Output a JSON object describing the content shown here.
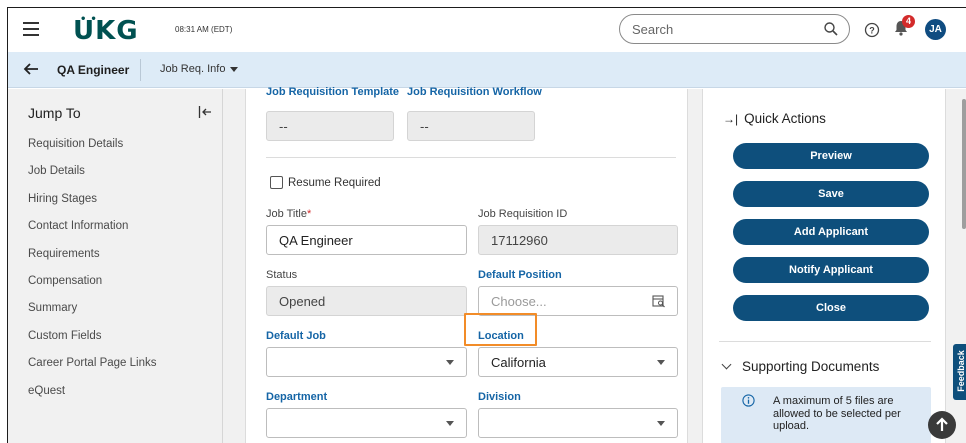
{
  "header": {
    "logo_text": "UKG",
    "logo_dots": "••",
    "time": "08:31 AM (EDT)",
    "search_placeholder": "Search",
    "notification_count": "4",
    "user_initials": "JA",
    "help_glyph": "?"
  },
  "subheader": {
    "back_glyph": "←",
    "title": "QA Engineer",
    "section_menu": "Job Req. Info"
  },
  "jump_to": {
    "title": "Jump To",
    "collapse_glyph": "|←",
    "items": [
      "Requisition Details",
      "Job Details",
      "Hiring Stages",
      "Contact Information",
      "Requirements",
      "Compensation",
      "Summary",
      "Custom Fields",
      "Career Portal Page Links",
      "eQuest"
    ]
  },
  "form": {
    "template_label": "Job Requisition Template",
    "template_value": "--",
    "workflow_label": "Job Requisition Workflow",
    "workflow_value": "--",
    "resume_required_label": "Resume Required",
    "resume_required_checked": false,
    "job_title_label": "Job Title",
    "required_mark": "*",
    "job_title_value": "QA Engineer",
    "req_id_label": "Job Requisition ID",
    "req_id_value": "17112960",
    "status_label": "Status",
    "status_value": "Opened",
    "default_position_label": "Default Position",
    "default_position_placeholder": "Choose...",
    "default_job_label": "Default Job",
    "default_job_value": "",
    "location_label": "Location",
    "location_value": "California",
    "department_label": "Department",
    "department_value": "",
    "division_label": "Division",
    "division_value": ""
  },
  "quick_actions": {
    "title": "Quick Actions",
    "title_glyph": "→|",
    "buttons": [
      "Preview",
      "Save",
      "Add Applicant",
      "Notify Applicant",
      "Close"
    ]
  },
  "supporting_documents": {
    "title": "Supporting Documents",
    "info_text": "A maximum of 5 files are allowed to be selected per upload."
  },
  "feedback_label": "Feedback",
  "colors": {
    "brand": "#005151",
    "primary_button": "#0e4f7c",
    "subheader_bg": "#ddebf7",
    "link_label": "#1565a6",
    "highlight": "#f28c28",
    "badge": "#d32b2b"
  }
}
